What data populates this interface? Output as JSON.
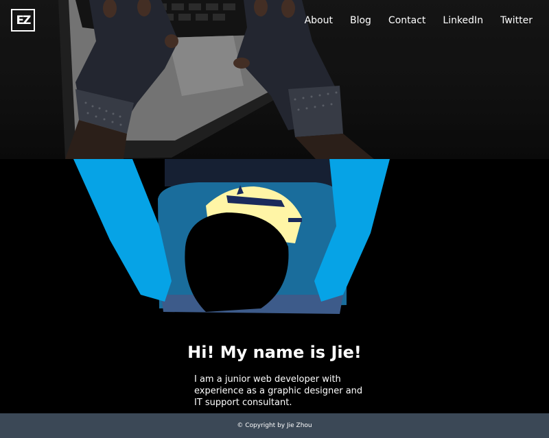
{
  "brand": {
    "logo_text": "EZ"
  },
  "nav": {
    "items": [
      {
        "label": "About"
      },
      {
        "label": "Blog"
      },
      {
        "label": "Contact"
      },
      {
        "label": "LinkedIn"
      },
      {
        "label": "Twitter"
      }
    ]
  },
  "hero": {
    "image": "laptop-hands-gloves-photo"
  },
  "illustration": {
    "image": "developer-top-down-illustration",
    "accent_color": "#06a3e6"
  },
  "intro": {
    "heading": "Hi! My name is Jie!",
    "body": "I am a junior web developer with experience as a graphic designer and IT support consultant."
  },
  "footer": {
    "copyright": "© Copyright by Jie Zhou",
    "background": "#3b4856"
  }
}
